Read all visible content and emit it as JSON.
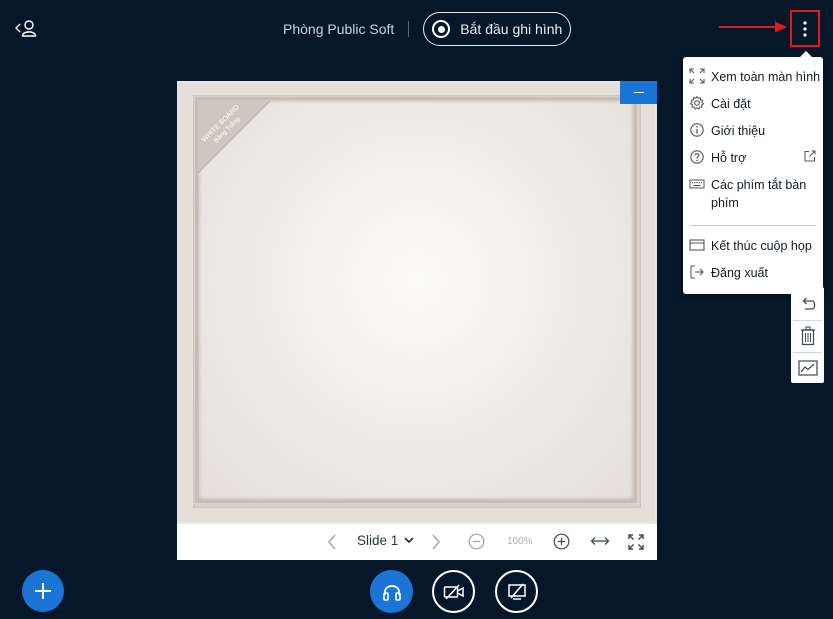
{
  "header": {
    "room_name": "Phòng Public Soft",
    "record_label": "Bắt đầu ghi hình"
  },
  "menu": {
    "items": [
      {
        "label": "Xem toàn màn hình",
        "icon": "fullscreen-icon"
      },
      {
        "label": "Cài đặt",
        "icon": "gear-icon"
      },
      {
        "label": "Giới thiệu",
        "icon": "info-icon"
      },
      {
        "label": "Hỗ trợ",
        "icon": "help-icon"
      },
      {
        "label": "Các phím tắt bàn phím",
        "icon": "keyboard-icon"
      },
      {
        "label": "Kết thúc cuộp họp",
        "icon": "end-meeting-icon"
      },
      {
        "label": "Đăng xuất",
        "icon": "logout-icon"
      }
    ]
  },
  "whiteboard": {
    "corner_text_line1": "WHITE BOARD",
    "corner_text_line2": "Bảng Trắng"
  },
  "presentation_toolbar": {
    "slide_label": "Slide 1",
    "zoom": "100%"
  },
  "tools": [
    "undo-icon",
    "trash-icon",
    "multi-user-whiteboard-icon"
  ],
  "colors": {
    "background": "#06172a",
    "accent": "#1b75d6",
    "annotation": "#e0191f"
  }
}
